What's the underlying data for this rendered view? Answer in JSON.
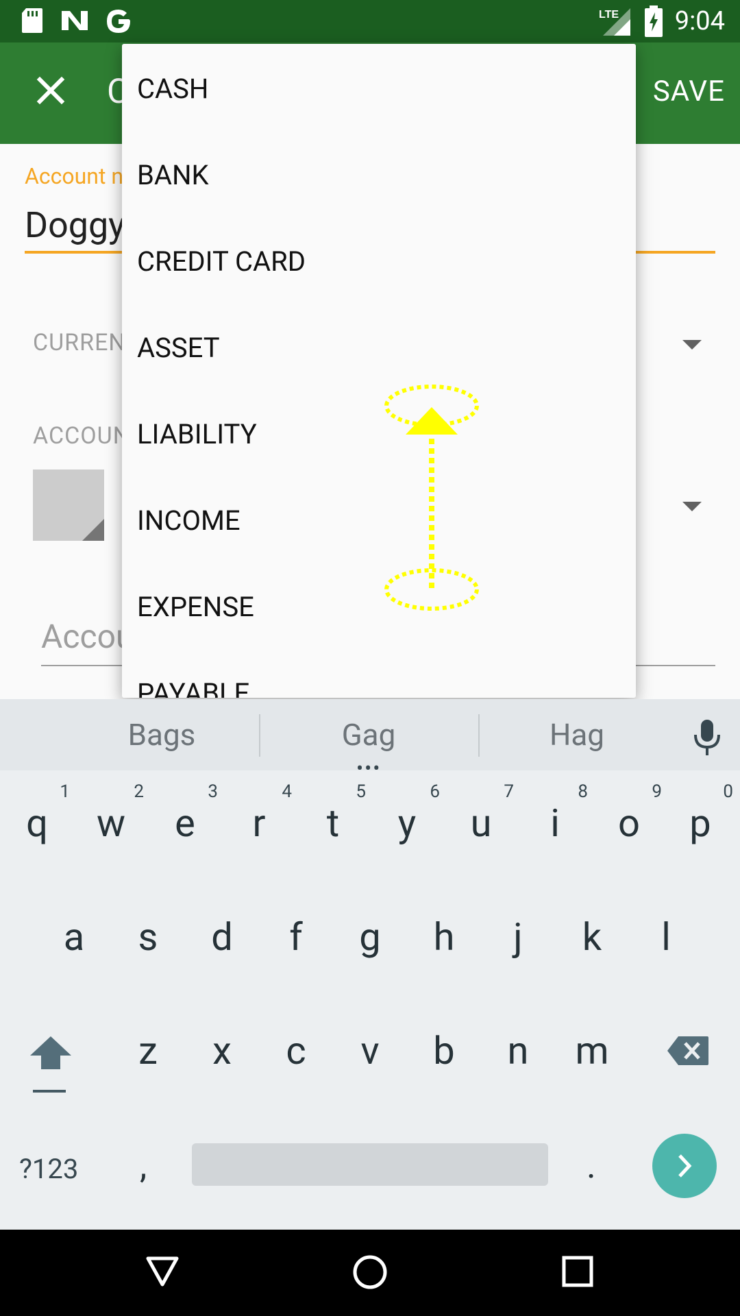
{
  "status_bar": {
    "time": "9:04",
    "network": "LTE",
    "icons": [
      "sd-card-icon",
      "n-notification-icon",
      "google-icon",
      "signal-icon",
      "battery-charging-icon"
    ]
  },
  "app_bar": {
    "title": "C",
    "save_label": "SAVE",
    "close_icon": "close-icon"
  },
  "form": {
    "name_label": "Account n",
    "name_value": "Doggy",
    "currency_label": "CURREN",
    "account_label": "ACCOUN",
    "description_placeholder": "Accou"
  },
  "dropdown": {
    "items": [
      "CASH",
      "BANK",
      "CREDIT CARD",
      "ASSET",
      "LIABILITY",
      "INCOME",
      "EXPENSE",
      "PAYABLE"
    ]
  },
  "gesture": {
    "type": "swipe-up",
    "color": "#ffff00"
  },
  "keyboard": {
    "suggestions": [
      "Bags",
      "Gag",
      "Hag"
    ],
    "row1": [
      {
        "k": "q",
        "h": "1"
      },
      {
        "k": "w",
        "h": "2"
      },
      {
        "k": "e",
        "h": "3"
      },
      {
        "k": "r",
        "h": "4"
      },
      {
        "k": "t",
        "h": "5"
      },
      {
        "k": "y",
        "h": "6"
      },
      {
        "k": "u",
        "h": "7"
      },
      {
        "k": "i",
        "h": "8"
      },
      {
        "k": "o",
        "h": "9"
      },
      {
        "k": "p",
        "h": "0"
      }
    ],
    "row2": [
      "a",
      "s",
      "d",
      "f",
      "g",
      "h",
      "j",
      "k",
      "l"
    ],
    "row3": [
      "z",
      "x",
      "c",
      "v",
      "b",
      "n",
      "m"
    ],
    "symbols_label": "?123",
    "comma": ",",
    "period": ".",
    "accent_color": "#4db6ac"
  },
  "nav_bar": {
    "icons": [
      "back-icon",
      "home-icon",
      "recents-icon"
    ]
  }
}
